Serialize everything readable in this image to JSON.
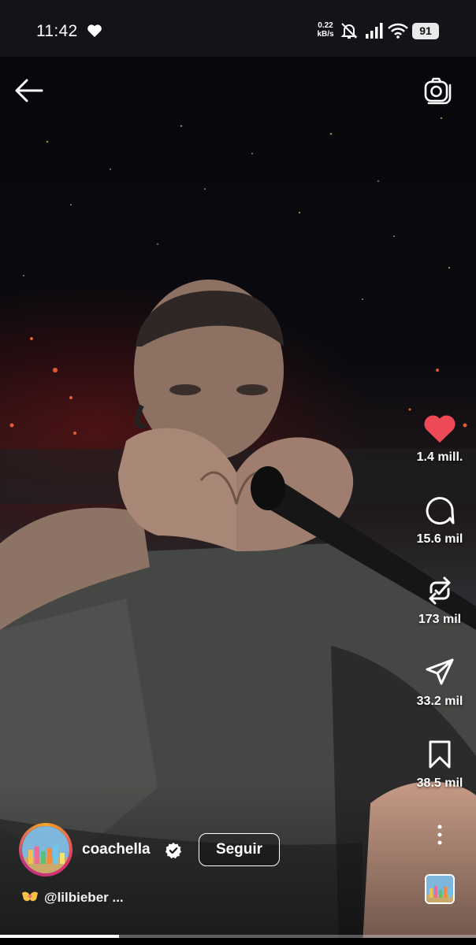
{
  "status_bar": {
    "time": "11:42",
    "network_speed_value": "0.22",
    "network_speed_unit": "kB/s",
    "battery": "91",
    "icons": [
      "heart-icon",
      "mute-bell-icon",
      "signal-icon",
      "wifi-icon",
      "battery-icon"
    ]
  },
  "top_bar": {
    "back_icon": "arrow-left-icon",
    "camera_icon": "camera-icon"
  },
  "actions": {
    "like": {
      "icon": "heart-filled-icon",
      "count": "1.4 mill.",
      "color": "#ed4956"
    },
    "comment": {
      "icon": "comment-icon",
      "count": "15.6 mil"
    },
    "repost": {
      "icon": "repost-icon",
      "count": "173 mil"
    },
    "share": {
      "icon": "send-icon",
      "count": "33.2 mil"
    },
    "save": {
      "icon": "bookmark-icon",
      "count": "38.5 mil"
    },
    "more_icon": "more-vertical-icon"
  },
  "author": {
    "name": "coachella",
    "verified": true,
    "follow_label": "Seguir"
  },
  "caption": {
    "text": "@lilbieber ..."
  },
  "playback": {
    "progress_fraction": 0.25
  },
  "colors": {
    "like_red": "#ed4956",
    "status_bg": "#131318"
  }
}
